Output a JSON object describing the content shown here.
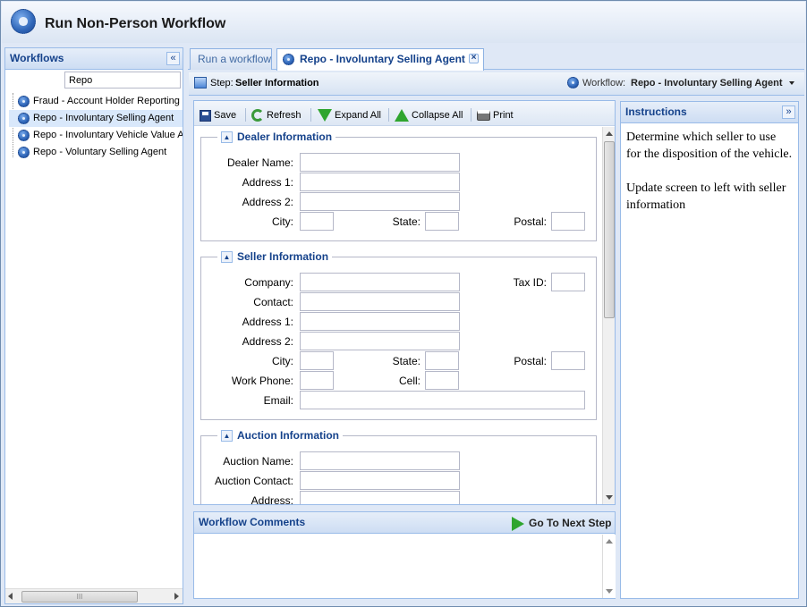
{
  "app": {
    "title": "Run Non-Person Workflow"
  },
  "sidebar": {
    "title": "Workflows",
    "collapse_icon": "double-chevron-left-icon",
    "search_value": "Repo",
    "items": [
      {
        "label": "Fraud - Account Holder Reporting"
      },
      {
        "label": "Repo - Involuntary Selling Agent"
      },
      {
        "label": "Repo - Involuntary Vehicle Value Adjustment"
      },
      {
        "label": "Repo - Voluntary Selling Agent"
      }
    ],
    "hscroll_grip": "III"
  },
  "tabs": [
    {
      "label": "Run a workflow"
    },
    {
      "label": "Repo - Involuntary Selling Agent",
      "close": "×"
    }
  ],
  "stepbar": {
    "step_prefix": "Step:",
    "step_name": "Seller Information",
    "workflow_prefix": "Workflow:",
    "workflow_name": "Repo - Involuntary Selling Agent"
  },
  "toolbar": {
    "save": "Save",
    "refresh": "Refresh",
    "expand_all": "Expand All",
    "collapse_all": "Collapse All",
    "print": "Print"
  },
  "dealer": {
    "legend": "Dealer Information",
    "name": "Dealer Name:",
    "address1": "Address 1:",
    "address2": "Address 2:",
    "city": "City:",
    "state": "State:",
    "postal": "Postal:"
  },
  "seller": {
    "legend": "Seller Information",
    "company": "Company:",
    "tax_id": "Tax ID:",
    "contact": "Contact:",
    "address1": "Address 1:",
    "address2": "Address 2:",
    "city": "City:",
    "state": "State:",
    "postal": "Postal:",
    "work_phone": "Work Phone:",
    "cell": "Cell:",
    "email": "Email:"
  },
  "auction": {
    "legend": "Auction Information",
    "name": "Auction Name:",
    "contact": "Auction Contact:",
    "address": "Address:"
  },
  "comments": {
    "title": "Workflow Comments",
    "next_step": "Go To Next Step"
  },
  "instructions": {
    "title": "Instructions",
    "expand_icon": "double-chevron-right-icon",
    "para1": "Determine which seller to use for the disposition of the vehicle.",
    "para2": "Update screen to left with seller information"
  },
  "colors": {
    "accent": "#15428b",
    "border": "#99bbe8",
    "bg": "#dfe8f6"
  }
}
